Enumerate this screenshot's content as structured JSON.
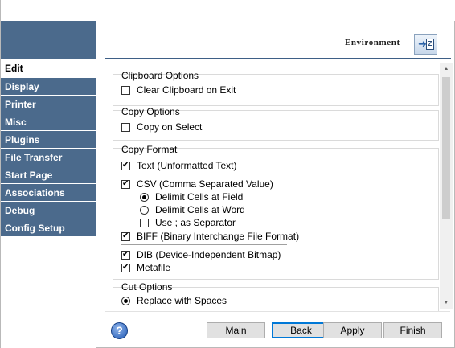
{
  "nav": {
    "items": [
      {
        "label": "Edit",
        "active": true
      },
      {
        "label": "Display",
        "active": false
      },
      {
        "label": "Printer",
        "active": false
      },
      {
        "label": "Misc",
        "active": false
      },
      {
        "label": "Plugins",
        "active": false
      },
      {
        "label": "File Transfer",
        "active": false
      },
      {
        "label": "Start Page",
        "active": false
      },
      {
        "label": "Associations",
        "active": false
      },
      {
        "label": "Debug",
        "active": false
      },
      {
        "label": "Config Setup",
        "active": false
      }
    ]
  },
  "header": {
    "section_label": "Environment",
    "icon": "environment-icon"
  },
  "clipboard_options": {
    "title": "Clipboard Options",
    "clear_on_exit": {
      "label": "Clear Clipboard on Exit",
      "checked": false
    }
  },
  "copy_options": {
    "title": "Copy Options",
    "copy_on_select": {
      "label": "Copy on Select",
      "checked": false
    }
  },
  "copy_format": {
    "title": "Copy Format",
    "text": {
      "label": "Text (Unformatted Text)",
      "checked": true
    },
    "csv": {
      "label": "CSV (Comma Separated Value)",
      "checked": true
    },
    "delimit_field": {
      "label": "Delimit Cells at Field",
      "checked": true
    },
    "delimit_word": {
      "label": "Delimit Cells at Word",
      "checked": false
    },
    "use_semicolon": {
      "label": "Use ; as Separator",
      "checked": false
    },
    "biff": {
      "label": "BIFF (Binary Interchange File Format)",
      "checked": true
    },
    "dib": {
      "label": "DIB (Device-Independent Bitmap)",
      "checked": true
    },
    "metafile": {
      "label": "Metafile",
      "checked": true
    }
  },
  "cut_options": {
    "title": "Cut Options",
    "replace_with_spaces": {
      "label": "Replace with Spaces",
      "checked": true
    }
  },
  "footer": {
    "help_icon": "help-icon",
    "help_glyph": "?",
    "main_label": "Main",
    "back_label": "Back",
    "apply_label": "Apply",
    "finish_label": "Finish"
  },
  "colors": {
    "nav_background": "#4b6a8c",
    "header_rule": "#3e5f86",
    "default_button_border": "#0078d7"
  }
}
